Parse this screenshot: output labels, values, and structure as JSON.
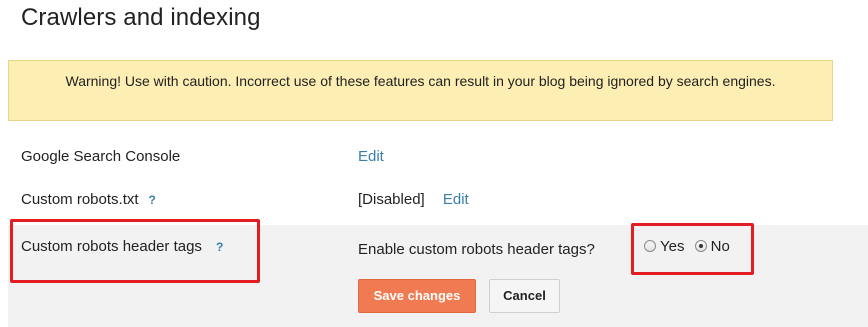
{
  "section": {
    "title": "Crawlers and indexing"
  },
  "warning": {
    "text": "Warning! Use with caution. Incorrect use of these features can result in your blog being ignored by search engines."
  },
  "settings": {
    "search_console": {
      "label": "Google Search Console",
      "edit_label": "Edit"
    },
    "robots_txt": {
      "label": "Custom robots.txt",
      "help": "?",
      "status": "[Disabled]",
      "edit_label": "Edit"
    },
    "robots_header_tags": {
      "label": "Custom robots header tags",
      "help": "?",
      "question": "Enable custom robots header tags?",
      "options": [
        {
          "label": "Yes",
          "checked": false
        },
        {
          "label": "No",
          "checked": true
        }
      ],
      "save_label": "Save changes",
      "cancel_label": "Cancel"
    }
  },
  "colors": {
    "warning_bg": "#fdeeb3",
    "link": "#3a7fa8",
    "save_button": "#f07b53",
    "highlight": "#e41c24"
  }
}
